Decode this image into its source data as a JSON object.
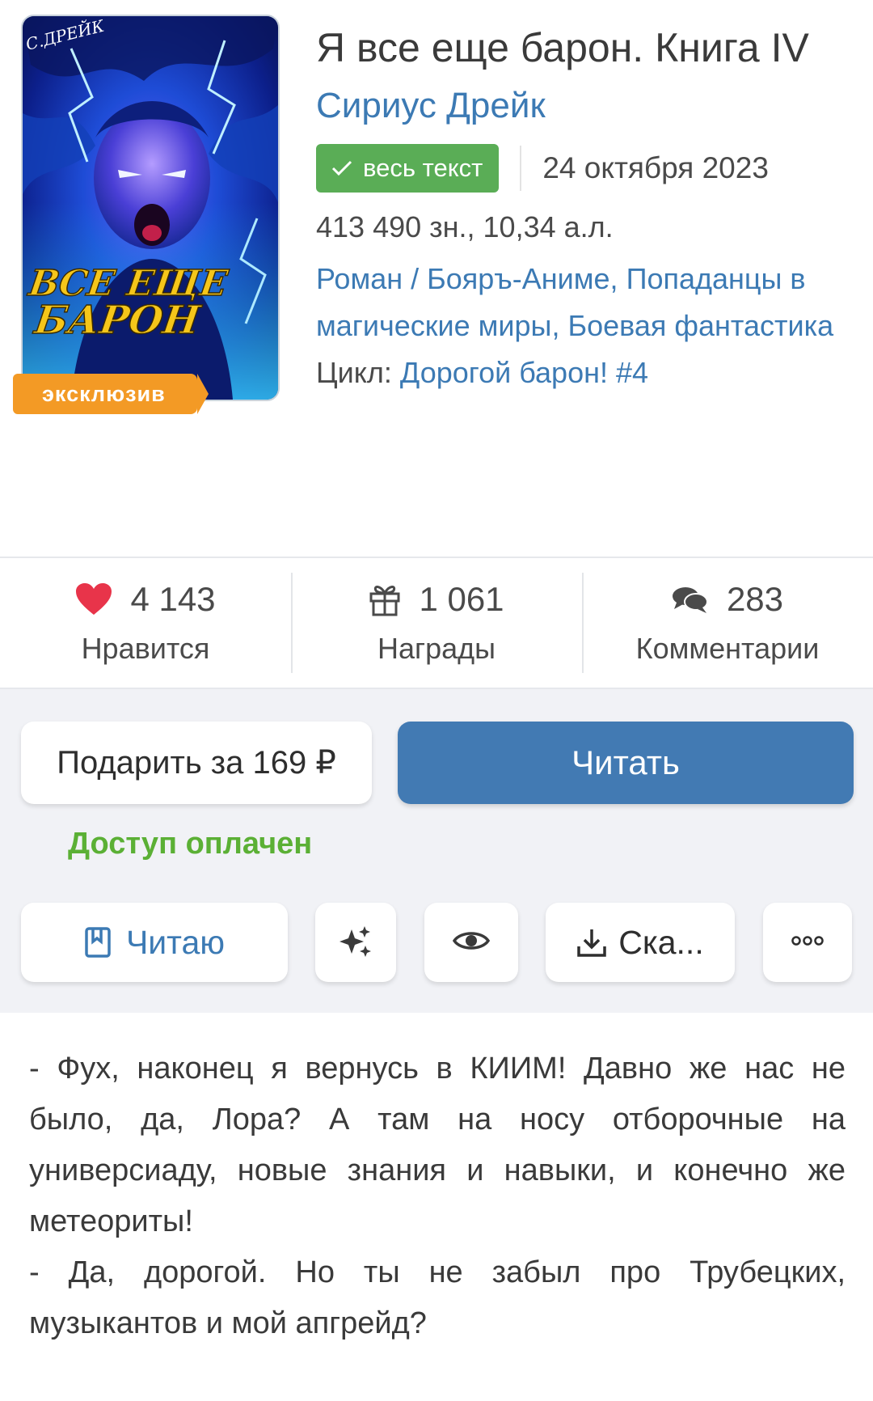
{
  "book": {
    "title": "Я все еще барон. Книга IV",
    "author": "Сириус Дрейк",
    "status_chip": "весь текст",
    "date": "24 октября 2023",
    "size": "413 490 зн., 10,34 а.л.",
    "genres": [
      "Роман / Бояръ-Аниме",
      "Попаданцы в магические миры",
      "Боевая фантастика"
    ],
    "series_label": "Цикл:",
    "series_name": "Дорогой барон! #4",
    "cover": {
      "badge": "эксклюзив",
      "author_text": "С.ДРЕЙК",
      "title_line1": "Я ВСЕ ЕЩЕ",
      "title_line2": "БАРОН"
    }
  },
  "counters": {
    "likes": {
      "value": "4 143",
      "label": "Нравится",
      "icon": "heart-icon"
    },
    "awards": {
      "value": "1 061",
      "label": "Награды",
      "icon": "gift-icon"
    },
    "comments": {
      "value": "283",
      "label": "Комментарии",
      "icon": "comments-icon"
    }
  },
  "actions": {
    "gift_label": "Подарить за 169 ₽",
    "read_label": "Читать",
    "access_text": "Доступ оплачен",
    "reading_label": "Читаю",
    "download_label": "Ска...",
    "icons": [
      "bookmark-icon",
      "sparkles-icon",
      "eye-icon",
      "download-icon",
      "more-icon"
    ]
  },
  "annotation": {
    "p1": "- Фух, наконец я вернусь в КИИМ! Давно же нас не было, да, Лора? А там на носу отборочные на универсиаду, новые знания и навыки, и конечно же метеориты!",
    "p2": "- Да, дорогой. Но ты не забыл про Трубецких, музыкантов и мой апгрейд?"
  },
  "colors": {
    "link": "#3c7ab4",
    "chip_green": "#5aad56",
    "read_button": "#427ab3",
    "access_green": "#5bb035",
    "badge_orange": "#f39a25",
    "heart_red": "#e8344a"
  }
}
